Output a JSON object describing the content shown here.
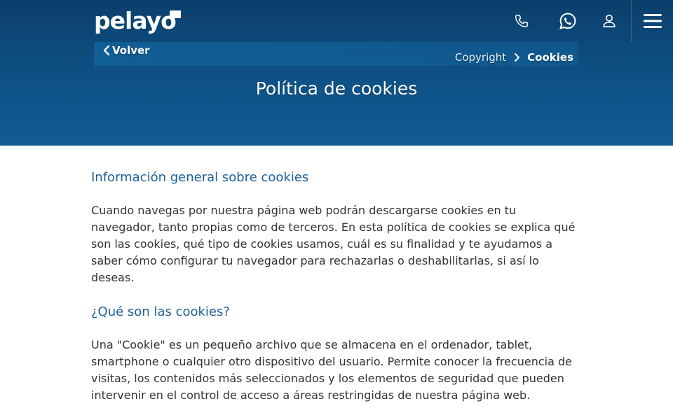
{
  "header": {
    "logo_text": "pelayo",
    "icons": [
      "phone-icon",
      "whatsapp-icon",
      "user-icon",
      "menu-icon"
    ]
  },
  "nav": {
    "back_label": "Volver",
    "breadcrumb": [
      "Copyright",
      "Cookies"
    ]
  },
  "page": {
    "title": "Política de cookies"
  },
  "sections": [
    {
      "heading": "Información general sobre cookies",
      "text": "Cuando navegas por nuestra página web podrán descargarse cookies en tu navegador, tanto propias como de terceros. En esta política de cookies se explica qué son las cookies, qué tipo de cookies usamos, cuál es su finalidad y te ayudamos a saber cómo configurar tu navegador para rechazarlas o deshabilitarlas, si así lo deseas."
    },
    {
      "heading": "¿Qué son las cookies?",
      "text": "Una \"Cookie\" es un pequeño archivo que se almacena en el ordenador, tablet, smartphone o cualquier otro dispositivo del usuario. Permite conocer la frecuencia de visitas, los contenidos más seleccionados y los elementos de seguridad que pueden intervenir en el control de acceso a áreas restringidas de nuestra página web."
    }
  ],
  "colors": {
    "header_bg": "#0e5286",
    "heading": "#1c5f96",
    "body_text": "#333333"
  }
}
